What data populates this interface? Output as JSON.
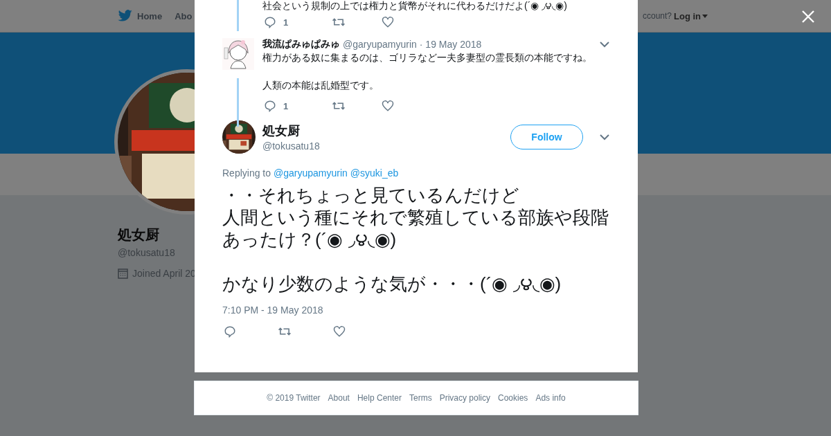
{
  "background_page": {
    "nav": {
      "items": [
        {
          "label": "Home"
        },
        {
          "label": "Abo"
        }
      ],
      "account_prompt": "ccount?",
      "login": "Log in"
    },
    "profile": {
      "name": "処女厨",
      "handle": "@tokusatu18",
      "joined": "Joined April 20",
      "avatar": {
        "kind": "picture"
      }
    }
  },
  "modal": {
    "thread": [
      {
        "text": "社会という規制の上では権力と貨幣がそれに代わるだけだよ(´◉ ◞౪◟◉)",
        "reply_count": "1"
      },
      {
        "author": "我流ぱみゅぱみゅ",
        "handle": "@garyupamyurin",
        "date": "· 19 May 2018",
        "paragraphs": [
          "権力がある奴に集まるのは、ゴリラなど一夫多妻型の霊長類の本能ですね。",
          "人類の本能は乱婚型です。"
        ],
        "reply_count": "1",
        "avatar": {
          "kind": "picture"
        }
      }
    ],
    "tweet": {
      "author": "処女厨",
      "handle": "@tokusatu18",
      "follow": "Follow",
      "replying_label": "Replying to",
      "replying_to": [
        "@garyupamyurin",
        "@syuki_eb"
      ],
      "paragraphs": [
        [
          "・・それちょっと見ているんだけど",
          "人間という種にそれで繁殖している部族や段階あったけ？(´◉ ◞౪◟◉)"
        ],
        [
          "かなり少数のような気が・・・(´◉ ◞౪◟◉)"
        ]
      ],
      "timestamp": "7:10 PM - 19 May 2018",
      "avatar": {
        "kind": "picture"
      }
    }
  },
  "footer": {
    "links": [
      "© 2019 Twitter",
      "About",
      "Help Center",
      "Terms",
      "Privacy policy",
      "Cookies",
      "Ads info"
    ]
  }
}
